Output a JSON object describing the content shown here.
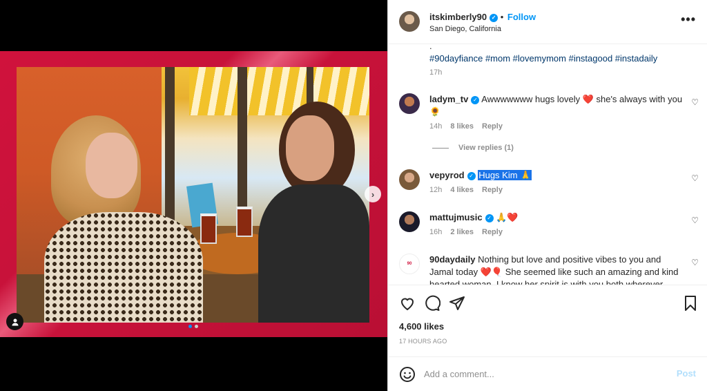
{
  "post": {
    "username": "itskimberly90",
    "follow_label": "Follow",
    "location": "San Diego, California",
    "more_label": "•••",
    "caption_dot": ".",
    "hashtags": "#90dayfiance #mom #lovemymom #instagood #instadaily",
    "caption_time": "17h",
    "likes": "4,600 likes",
    "time_ago": "17 HOURS AGO",
    "carousel": {
      "slide_count": 2,
      "active_slide": 1
    }
  },
  "comments": [
    {
      "user": "ladym_tv",
      "text": "Awwwwwww hugs lovely ❤️ she's always with you 🌻",
      "time": "14h",
      "likes": "8 likes",
      "reply": "Reply",
      "verified": true
    },
    {
      "user": "vepyrod",
      "text": "Hugs Kim 🙏",
      "time": "12h",
      "likes": "4 likes",
      "reply": "Reply",
      "verified": true
    },
    {
      "user": "mattujmusic",
      "text": "🙏❤️",
      "time": "16h",
      "likes": "2 likes",
      "reply": "Reply",
      "verified": true
    },
    {
      "user": "90daydaily",
      "text": "Nothing but love and positive vibes to you and Jamal today ❤️🎈 She seemed like such an amazing and kind hearted woman. I know her spirit is with you both wherever",
      "verified": false
    }
  ],
  "view_replies": "View replies (1)",
  "add_comment": {
    "placeholder": "Add a comment...",
    "post_label": "Post"
  },
  "icons": {
    "like": "heart-icon",
    "comment": "comment-icon",
    "share": "paper-plane-icon",
    "save": "bookmark-icon",
    "emoji": "smiley-icon",
    "next": "chevron-right-icon",
    "tag": "user-tag-icon",
    "more": "more-options-icon"
  },
  "colors": {
    "accent": "#0095f6",
    "frame": "#c8123a",
    "text": "#262626",
    "muted": "#8e8e8e",
    "hashtag": "#00376b",
    "highlight": "#1a73e8"
  }
}
